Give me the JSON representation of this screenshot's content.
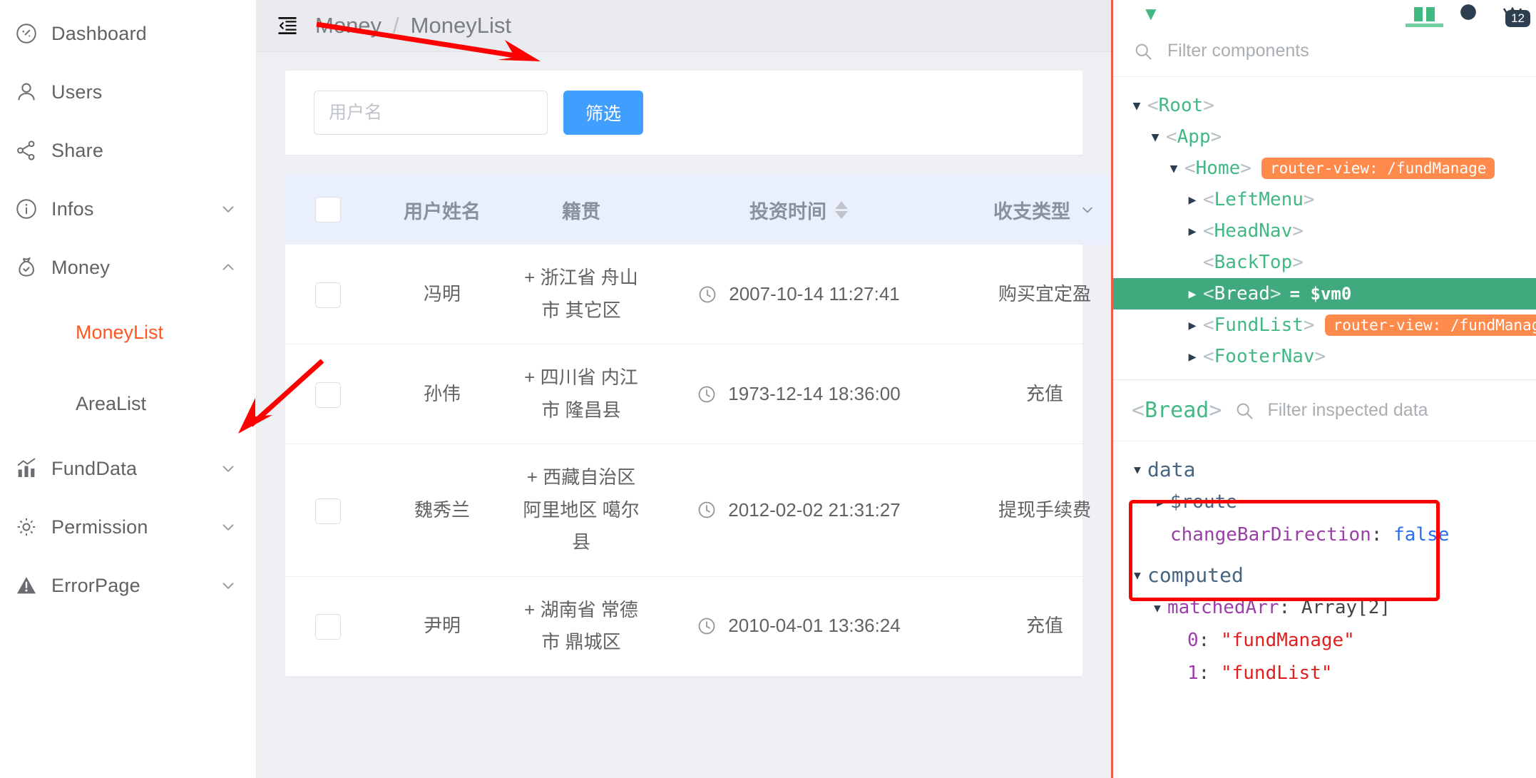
{
  "sidebar": {
    "items": [
      {
        "label": "Dashboard",
        "icon": "dashboard-icon",
        "expandable": false,
        "arrow": ""
      },
      {
        "label": "Users",
        "icon": "user-icon",
        "expandable": false,
        "arrow": ""
      },
      {
        "label": "Share",
        "icon": "share-icon",
        "expandable": false,
        "arrow": ""
      },
      {
        "label": "Infos",
        "icon": "info-icon",
        "expandable": true,
        "arrow": "chevron-down"
      },
      {
        "label": "Money",
        "icon": "money-bag-icon",
        "expandable": true,
        "arrow": "chevron-up"
      }
    ],
    "submenu": [
      {
        "label": "MoneyList",
        "active": true
      },
      {
        "label": "AreaList",
        "active": false
      }
    ],
    "items_after": [
      {
        "label": "FundData",
        "icon": "chart-icon",
        "expandable": true,
        "arrow": "chevron-down"
      },
      {
        "label": "Permission",
        "icon": "gear-icon",
        "expandable": true,
        "arrow": "chevron-down"
      },
      {
        "label": "ErrorPage",
        "icon": "warning-icon",
        "expandable": true,
        "arrow": "chevron-down"
      }
    ],
    "active_color": "#ff5722"
  },
  "topbar": {
    "collapse_icon": "collapse-menu-icon",
    "breadcrumb": [
      "Money",
      "MoneyList"
    ],
    "separator": "/"
  },
  "filter": {
    "placeholder": "用户名",
    "value": "",
    "button_label": "筛选",
    "button_color": "#409eff"
  },
  "table": {
    "columns": [
      {
        "key": "check",
        "label": "",
        "type": "checkbox"
      },
      {
        "key": "name",
        "label": "用户姓名",
        "type": "text"
      },
      {
        "key": "home",
        "label": "籍贯",
        "type": "text"
      },
      {
        "key": "time",
        "label": "投资时间",
        "type": "sortable"
      },
      {
        "key": "type",
        "label": "收支类型",
        "type": "filterable"
      }
    ],
    "rows": [
      {
        "name": "冯明",
        "home": "+ 浙江省 舟山市 其它区",
        "time": "2007-10-14 11:27:41",
        "type": "购买宜定盈"
      },
      {
        "name": "孙伟",
        "home": "+ 四川省 内江市 隆昌县",
        "time": "1973-12-14 18:36:00",
        "type": "充值"
      },
      {
        "name": "魏秀兰",
        "home": "+ 西藏自治区 阿里地区 噶尔县",
        "time": "2012-02-02 21:31:27",
        "type": "提现手续费"
      },
      {
        "name": "尹明",
        "home": "+ 湖南省 常德市 鼎城区",
        "time": "2010-04-01 13:36:24",
        "type": "充值"
      }
    ],
    "home_color": "#1ec11e",
    "header_bg": "#eaeffc"
  },
  "devtools": {
    "badge": "12",
    "component_search_placeholder": "Filter components",
    "inspect_search_placeholder": "Filter inspected data",
    "selected_component": "<Bread>",
    "tree": [
      {
        "depth": 0,
        "arrow": "down",
        "name": "<Root>",
        "pill": "",
        "vm": "",
        "selected": false
      },
      {
        "depth": 1,
        "arrow": "down",
        "name": "<App>",
        "pill": "",
        "vm": "",
        "selected": false
      },
      {
        "depth": 2,
        "arrow": "down",
        "name": "<Home>",
        "pill": "router-view: /fundManage",
        "vm": "",
        "selected": false
      },
      {
        "depth": 3,
        "arrow": "right",
        "name": "<LeftMenu>",
        "pill": "",
        "vm": "",
        "selected": false
      },
      {
        "depth": 3,
        "arrow": "right",
        "name": "<HeadNav>",
        "pill": "",
        "vm": "",
        "selected": false
      },
      {
        "depth": 3,
        "arrow": "none",
        "name": "<BackTop>",
        "pill": "",
        "vm": "",
        "selected": false
      },
      {
        "depth": 3,
        "arrow": "right",
        "name": "<Bread>",
        "pill": "",
        "vm": "= $vm0",
        "selected": true
      },
      {
        "depth": 3,
        "arrow": "right",
        "name": "<FundList>",
        "pill": "router-view: /fundManage/fundList",
        "vm": "",
        "selected": false
      },
      {
        "depth": 3,
        "arrow": "right",
        "name": "<FooterNav>",
        "pill": "",
        "vm": "",
        "selected": false
      }
    ],
    "inspected": {
      "groups": [
        {
          "name": "data",
          "arrow": "down",
          "rows": [
            {
              "arrow": "right",
              "key": "$route",
              "sep": "",
              "value": "",
              "value_kind": "none",
              "indent": 1
            },
            {
              "arrow": "none",
              "key": "changeBarDirection",
              "sep": ":",
              "value": "false",
              "value_kind": "bool",
              "indent": 1
            }
          ]
        },
        {
          "name": "computed",
          "arrow": "down",
          "rows": [
            {
              "arrow": "down",
              "key": "matchedArr",
              "sep": ":",
              "value": "Array[2]",
              "value_kind": "plain",
              "indent": 1
            },
            {
              "arrow": "none",
              "key": "0",
              "sep": ":",
              "value": "\"fundManage\"",
              "value_kind": "str",
              "indent": 2
            },
            {
              "arrow": "none",
              "key": "1",
              "sep": ":",
              "value": "\"fundList\"",
              "value_kind": "str",
              "indent": 2
            }
          ]
        }
      ]
    }
  },
  "annotations": {
    "arrow_color": "#ff0000",
    "highlight_box_color": "#ff0000"
  }
}
